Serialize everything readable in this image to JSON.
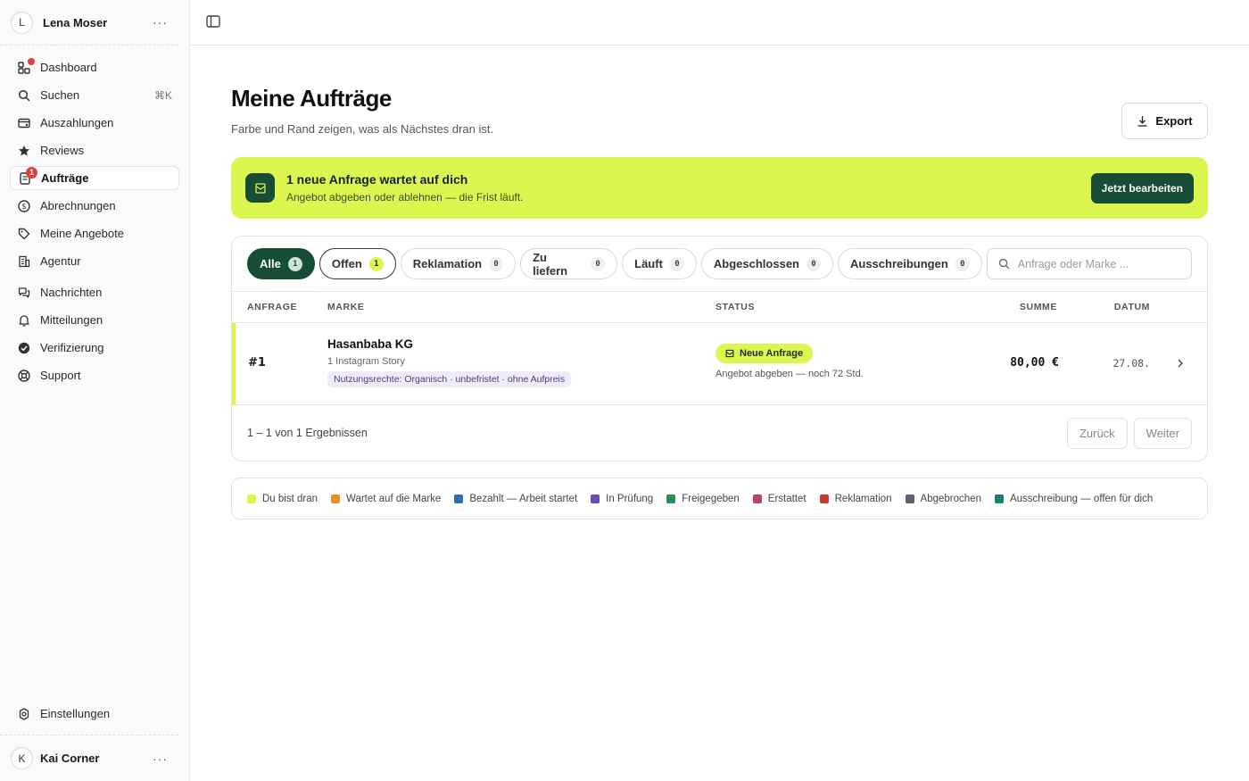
{
  "sidebar": {
    "user": {
      "initial": "L",
      "name": "Lena Moser",
      "more": "···"
    },
    "nav": [
      {
        "label": "Dashboard",
        "icon": "dashboard-icon"
      },
      {
        "label": "Suchen",
        "icon": "search-icon",
        "shortcut": "⌘K"
      },
      {
        "label": "Auszahlungen",
        "icon": "payout-icon"
      },
      {
        "label": "Reviews",
        "icon": "star-icon"
      },
      {
        "label": "Aufträge",
        "icon": "orders-icon",
        "badge": "1",
        "active": true
      },
      {
        "label": "Abrechnungen",
        "icon": "dollar-icon"
      },
      {
        "label": "Meine Angebote",
        "icon": "tag-icon"
      },
      {
        "label": "Agentur",
        "icon": "building-icon"
      },
      {
        "label": "Nachrichten",
        "icon": "chat-icon"
      },
      {
        "label": "Mitteilungen",
        "icon": "bell-icon"
      },
      {
        "label": "Verifizierung",
        "icon": "check-circle-icon"
      },
      {
        "label": "Support",
        "icon": "lifebuoy-icon"
      }
    ],
    "settings_label": "Einstellungen",
    "bottom_user": {
      "initial": "K",
      "name": "Kai Corner",
      "more": "···"
    }
  },
  "page": {
    "title": "Meine Aufträge",
    "subtitle": "Farbe und Rand zeigen, was als Nächstes dran ist.",
    "export_label": "Export"
  },
  "banner": {
    "title": "1 neue Anfrage wartet auf dich",
    "subtitle": "Angebot abgeben oder ablehnen — die Frist läuft.",
    "button": "Jetzt bearbeiten"
  },
  "filters": [
    {
      "label": "Alle",
      "count": "1"
    },
    {
      "label": "Offen",
      "count": "1"
    },
    {
      "label": "Reklamation",
      "count": "0"
    },
    {
      "label": "Zu liefern",
      "count": "0"
    },
    {
      "label": "Läuft",
      "count": "0"
    },
    {
      "label": "Abgeschlossen",
      "count": "0"
    },
    {
      "label": "Ausschreibungen",
      "count": "0"
    }
  ],
  "search": {
    "placeholder": "Anfrage oder Marke ..."
  },
  "table": {
    "headers": {
      "anfrage": "ANFRAGE",
      "marke": "MARKE",
      "status": "STATUS",
      "summe": "SUMME",
      "datum": "DATUM"
    },
    "rows": [
      {
        "id": "#1",
        "brand": "Hasanbaba KG",
        "deliverable": "1 Instagram Story",
        "rights": "Nutzungsrechte: Organisch · unbefristet · ohne Aufpreis",
        "status": "Neue Anfrage",
        "status_sub": "Angebot abgeben — noch 72 Std.",
        "sum": "80,00 €",
        "date": "27.08."
      }
    ]
  },
  "pagination": {
    "count_text": "1 – 1 von 1 Ergebnissen",
    "prev": "Zurück",
    "next": "Weiter"
  },
  "legend": [
    {
      "label": "Du bist dran",
      "color": "#ddf64f"
    },
    {
      "label": "Wartet auf die Marke",
      "color": "#e8912c"
    },
    {
      "label": "Bezahlt — Arbeit startet",
      "color": "#2f6db5"
    },
    {
      "label": "In Prüfung",
      "color": "#6a4bb0"
    },
    {
      "label": "Freigegeben",
      "color": "#2e8a55"
    },
    {
      "label": "Erstattet",
      "color": "#b5407a"
    },
    {
      "label": "Reklamation",
      "color": "#c83a2c"
    },
    {
      "label": "Abgebrochen",
      "color": "#5a6270"
    },
    {
      "label": "Ausschreibung — offen für dich",
      "color": "#1a7f72"
    }
  ],
  "colors": {
    "accent": "#ddf64f",
    "brand_dark": "#174d34",
    "alert": "#e04040"
  }
}
